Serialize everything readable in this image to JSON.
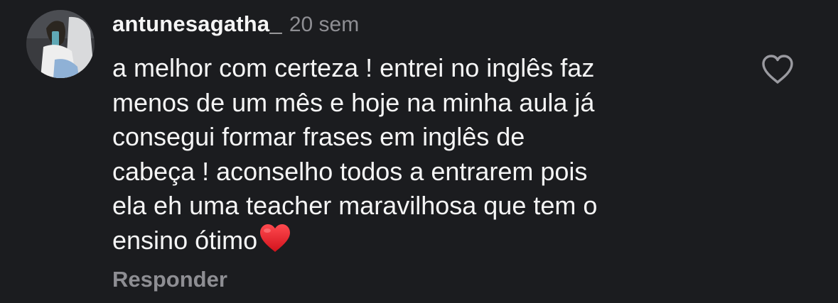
{
  "comment": {
    "username": "antunesagatha_",
    "time": "20 sem",
    "lines": [
      "a melhor com certeza ! entrei no inglês faz",
      "menos de um mês e hoje na minha aula já",
      "consegui formar frases em inglês de",
      "cabeça ! aconselho todos a entrarem pois",
      "ela eh uma teacher maravilhosa que tem o",
      "ensino ótimo"
    ],
    "trailing_emoji": "heart-emoji",
    "reply_label": "Responder",
    "like_icon": "heart-outline-icon"
  },
  "colors": {
    "background": "#1b1c1f",
    "text": "#f5f5f5",
    "secondary_text": "#8e8e93",
    "emoji_heart": "#e0242c"
  }
}
